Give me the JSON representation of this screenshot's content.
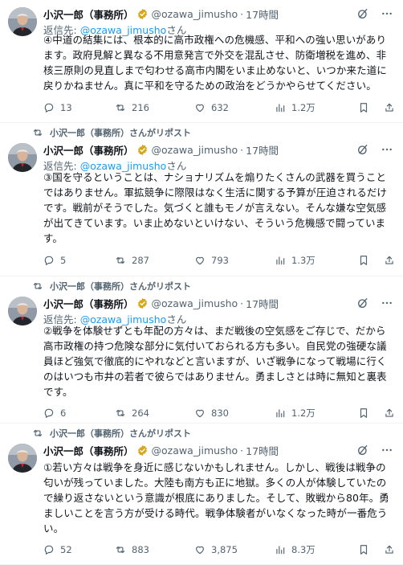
{
  "tweets": [
    {
      "reposted": false,
      "repost_label": "",
      "author": {
        "name": "小沢一郎（事務所）",
        "handle": "@ozawa_jimusho",
        "time": "17時間"
      },
      "reply": {
        "prefix": "返信先: ",
        "mention": "@ozawa_jimusho",
        "suffix": "さん"
      },
      "lines": [
        "④中道の結集には、根本的に高市政権への危機感、平和への強い思いがあり",
        "ます。政府見解と異なる不用意発言で外交を混乱させ、防衛増税を進め、非",
        "核三原則の見直しまで匂わせる高市内閣をいま止めないと、いつか来た道に",
        "戻りかねません。真に平和を守るための政治をどうかやらせてください。"
      ],
      "stats": {
        "replies": "13",
        "reposts": "216",
        "likes": "632",
        "views": "1.2万"
      }
    },
    {
      "reposted": true,
      "repost_label": "小沢一郎（事務所）さんがリポスト",
      "author": {
        "name": "小沢一郎（事務所）",
        "handle": "@ozawa_jimusho",
        "time": "17時間"
      },
      "reply": {
        "prefix": "返信先: ",
        "mention": "@ozawa_jimusho",
        "suffix": "さん"
      },
      "lines": [
        "③国を守るということは、ナショナリズムを煽りたくさんの武器を買うこと",
        "ではありません。軍拡競争に際限はなく生活に関する予算が圧迫されるだけ",
        "です。戦前がそうでした。気づくと誰もモノが言えない。そんな嫌な空気感",
        "が出てきています。いま止めないといけない、そういう危機感で闘っていま",
        "す。"
      ],
      "stats": {
        "replies": "5",
        "reposts": "287",
        "likes": "793",
        "views": "1.3万"
      }
    },
    {
      "reposted": true,
      "repost_label": "小沢一郎（事務所）さんがリポスト",
      "author": {
        "name": "小沢一郎（事務所）",
        "handle": "@ozawa_jimusho",
        "time": "17時間"
      },
      "reply": {
        "prefix": "返信先: ",
        "mention": "@ozawa_jimusho",
        "suffix": "さん"
      },
      "lines": [
        "②戦争を体験せずとも年配の方々は、まだ戦後の空気感をご存じで、だから",
        "高市政権の持つ危険な部分に気付いておられる方も多い。自民党の強硬な議",
        "員ほど強気で徹底的にやれなどと言いますが、いざ戦争になって戦場に行く",
        "のはいつも市井の若者で彼らではありません。勇ましさとは時に無知と裏表",
        "です。"
      ],
      "stats": {
        "replies": "6",
        "reposts": "264",
        "likes": "830",
        "views": "1.2万"
      }
    },
    {
      "reposted": true,
      "repost_label": "小沢一郎（事務所）さんがリポスト",
      "author": {
        "name": "小沢一郎（事務所）",
        "handle": "@ozawa_jimusho",
        "time": "17時間"
      },
      "reply": {
        "prefix": "",
        "mention": "",
        "suffix": ""
      },
      "lines": [
        "①若い方々は戦争を身近に感じないかもしれません。しかし、戦後は戦争の",
        "匂いが残っていました。大陸も南方も正に地獄。多くの人が体験していたの",
        "で繰り返さないという意識が根底にありました。そして、敗戦から80年。勇",
        "ましいことを言う方が受ける時代。戦争体験者がいなくなった時が一番危う",
        "い。"
      ],
      "stats": {
        "replies": "52",
        "reposts": "883",
        "likes": "3,875",
        "views": "8.3万"
      }
    }
  ],
  "colors": {
    "accent": "#1d9bf0",
    "muted": "#536471",
    "badge_gold": "#d6a71b",
    "text": "#0f1419"
  },
  "icons": [
    "repost-icon",
    "verified-badge-icon",
    "grok-icon",
    "more-icon",
    "reply-icon",
    "like-icon",
    "views-icon",
    "bookmark-icon",
    "share-icon"
  ]
}
